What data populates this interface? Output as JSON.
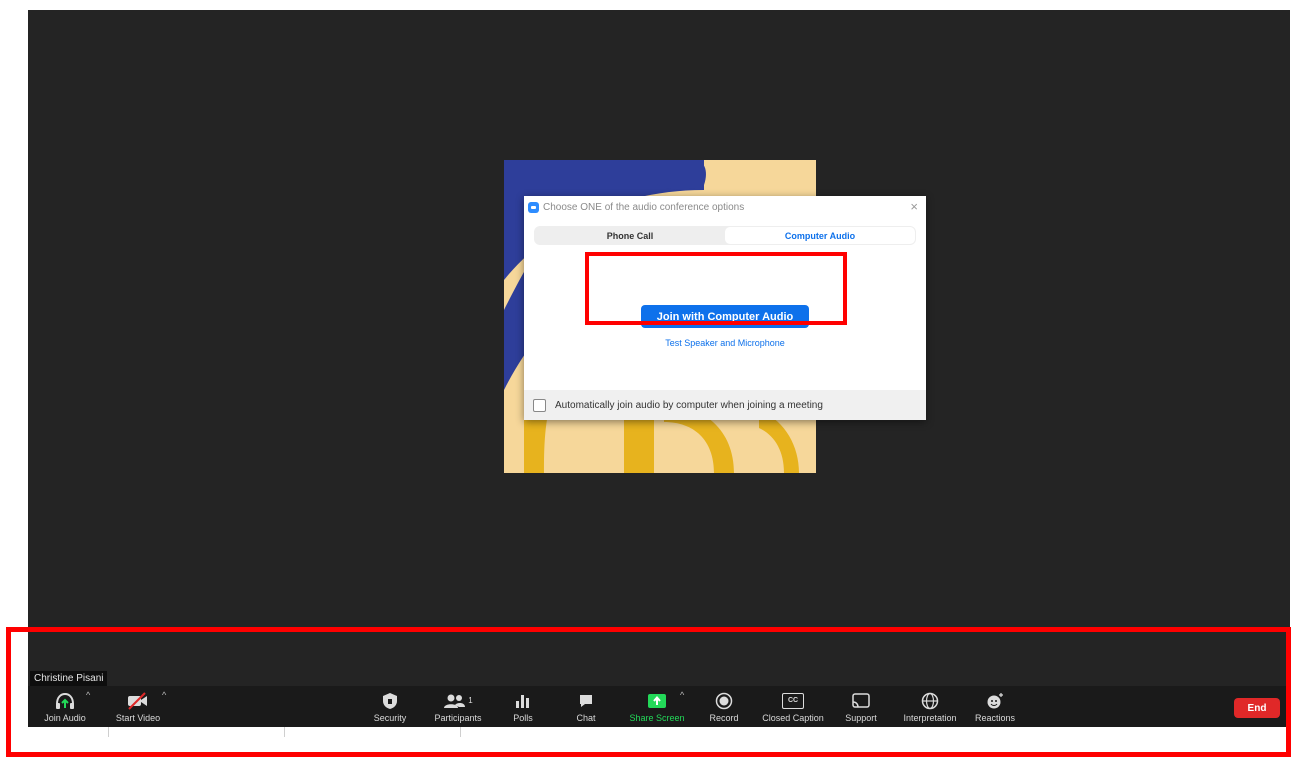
{
  "participant": {
    "name": "Christine Pisani"
  },
  "dialog": {
    "title": "Choose ONE of the audio conference options",
    "close_icon": "×",
    "tabs": [
      {
        "label": "Phone Call",
        "selected": false
      },
      {
        "label": "Computer Audio",
        "selected": true
      }
    ],
    "join_button": "Join with Computer Audio",
    "test_link": "Test Speaker and Microphone",
    "auto_join_label": "Automatically join audio by computer when joining a meeting",
    "auto_join_checked": false
  },
  "toolbar": {
    "join_audio": "Join Audio",
    "start_video": "Start Video",
    "security": "Security",
    "participants": "Participants",
    "participant_count": "1",
    "polls": "Polls",
    "chat": "Chat",
    "share_screen": "Share Screen",
    "record": "Record",
    "closed_caption": "Closed Caption",
    "closed_caption_icon_text": "CC",
    "support": "Support",
    "interpretation": "Interpretation",
    "reactions": "Reactions",
    "end": "End",
    "caret": "^"
  },
  "colors": {
    "accent_blue": "#0e71eb",
    "share_green": "#23d959",
    "end_red": "#e02828",
    "highlight_red": "#ff0000",
    "window_bg": "#242424",
    "toolbar_bg": "#1a1a1a",
    "tile_cream": "#f6d79a",
    "tile_navy": "#2e3e9a",
    "tile_gold": "#e7b31e"
  },
  "icons": {
    "join_audio": "headphones-icon",
    "start_video": "video-off-icon",
    "security": "shield-icon",
    "participants": "people-icon",
    "polls": "bar-chart-icon",
    "chat": "chat-bubble-icon",
    "share_screen": "share-arrow-icon",
    "record": "record-icon",
    "closed_caption": "cc-icon",
    "support": "cast-icon",
    "interpretation": "globe-icon",
    "reactions": "emoji-icon"
  }
}
